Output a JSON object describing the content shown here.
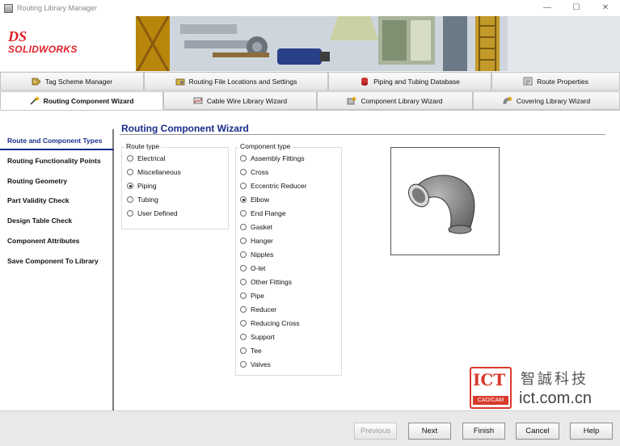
{
  "window": {
    "title": "Routing Library Manager",
    "minimize": "—",
    "maximize": "☐",
    "close": "✕"
  },
  "brand": {
    "logo_mark": "DS",
    "logo_text": "SOLIDWORKS"
  },
  "tabs_row1": [
    "Tag Scheme Manager",
    "Routing File Locations and Settings",
    "Piping and Tubing Database",
    "Route Properties"
  ],
  "tabs_row2": [
    "Routing Component Wizard",
    "Cable Wire Library Wizard",
    "Component Library Wizard",
    "Covering Library Wizard"
  ],
  "active_tab": "Routing Component Wizard",
  "left_nav": [
    "Route and Component Types",
    "Routing Functionality Points",
    "Routing Geometry",
    "Part Validity Check",
    "Design Table Check",
    "Component Attributes",
    "Save Component To Library"
  ],
  "active_step": "Route and Component Types",
  "wizard_title": "Routing Component Wizard",
  "route_type": {
    "label": "Route type",
    "options": [
      "Electrical",
      "Miscellaneous",
      "Piping",
      "Tubing",
      "User Defined"
    ],
    "selected": "Piping"
  },
  "component_type": {
    "label": "Component type",
    "options": [
      "Assembly Fittings",
      "Cross",
      "Eccentric Reducer",
      "Elbow",
      "End Flange",
      "Gasket",
      "Hanger",
      "Nipples",
      "O-let",
      "Other Fittings",
      "Pipe",
      "Reducer",
      "Reducing Cross",
      "Support",
      "Tee",
      "Valves"
    ],
    "selected": "Elbow"
  },
  "preview": {
    "subject": "elbow-fitting-3d"
  },
  "watermark": {
    "logo": "ICT",
    "sub": "CAD/CAM",
    "cn": "智誠科技",
    "url": "ict.com.cn"
  },
  "buttons": {
    "previous": "Previous",
    "next": "Next",
    "finish": "Finish",
    "cancel": "Cancel",
    "help": "Help"
  }
}
